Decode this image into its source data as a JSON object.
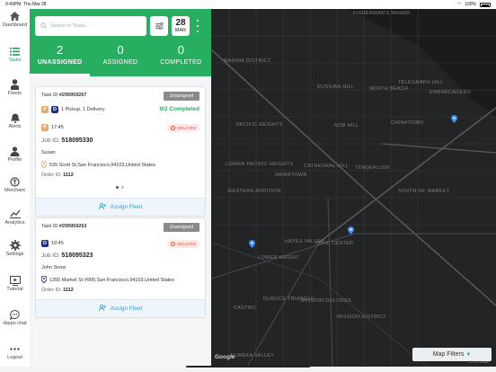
{
  "status_bar": {
    "time": "9:49PM",
    "date": "Thu Mar 28",
    "battery": "100%"
  },
  "sidebar": {
    "items": [
      {
        "label": "Dashboard",
        "icon": "home-icon"
      },
      {
        "label": "Tasks",
        "icon": "list-icon"
      },
      {
        "label": "Fleets",
        "icon": "person-icon"
      },
      {
        "label": "Alerts",
        "icon": "bell-icon"
      },
      {
        "label": "Profile",
        "icon": "user-icon"
      },
      {
        "label": "Merchant",
        "icon": "merchant-icon"
      },
      {
        "label": "Analytics",
        "icon": "chart-icon"
      },
      {
        "label": "Settings",
        "icon": "gear-icon"
      },
      {
        "label": "Tutorial",
        "icon": "tutorial-icon"
      },
      {
        "label": "Hippo chat",
        "icon": "chat-icon"
      },
      {
        "label": "Logout",
        "icon": "more-icon"
      }
    ]
  },
  "search": {
    "placeholder": "Search in Tasks..."
  },
  "date_box": {
    "day": "28",
    "month": "MAR"
  },
  "counts": [
    {
      "number": "2",
      "label": "UNASSIGNED"
    },
    {
      "number": "0",
      "label": "ASSIGNED"
    },
    {
      "number": "0",
      "label": "COMPLETED"
    }
  ],
  "cards": [
    {
      "task_id_prefix": "Task ID ",
      "task_id": "#299959267",
      "status": "Unassigned",
      "summary": "1 Pickup, 1 Delivery",
      "completed": "0/2 Completed",
      "time": "17:45",
      "delayed": "DELAYED",
      "job_id_prefix": "Job ID: ",
      "job_id": "518095330",
      "name": "Susan",
      "address": "535 Scott St,San Francisco,94103,United States",
      "order_prefix": "Order ID: ",
      "order_id": "1112",
      "assign": "Assign Fleet"
    },
    {
      "task_id_prefix": "Task ID ",
      "task_id": "#299959263",
      "status": "Unassigned",
      "time": "19:45",
      "delayed": "DELAYED",
      "job_id_prefix": "Job ID: ",
      "job_id": "518095323",
      "name": "John Snow",
      "address": "1355 Market St #900,San Francisco,94103,United States",
      "order_prefix": "Order ID: ",
      "order_id": "1112",
      "assign": "Assign Fleet"
    }
  ],
  "map": {
    "labels": [
      "FISHERMAN'S WHARF",
      "MARINA DISTRICT",
      "RUSSIAN HILL",
      "NORTH BEACH",
      "TELEGRAPH HILL",
      "EMBARCADERO",
      "PACIFIC HEIGHTS",
      "NOB HILL",
      "CHINATOWN",
      "LOWER PACIFIC HEIGHTS",
      "WESTERN ADDITION",
      "JAPANTOWN",
      "CATHEDRAL HILL",
      "TENDERLOIN",
      "SOUTH OF MARKET",
      "HAYES VALLEY",
      "LOWER HAIGHT",
      "CIVIC CENTER",
      "CASTRO",
      "MISSION DISTRICT",
      "DUBOCE TRIANGLE",
      "EUREKA VALLEY",
      "MISSION DOLORES"
    ],
    "filters": "Map Filters",
    "google": "Google",
    "copyright": "©2024 Google"
  },
  "colors": {
    "brand": "#27ae60",
    "link": "#2f9fd6",
    "delayed": "#e74c3c",
    "map_bg": "#232426"
  }
}
